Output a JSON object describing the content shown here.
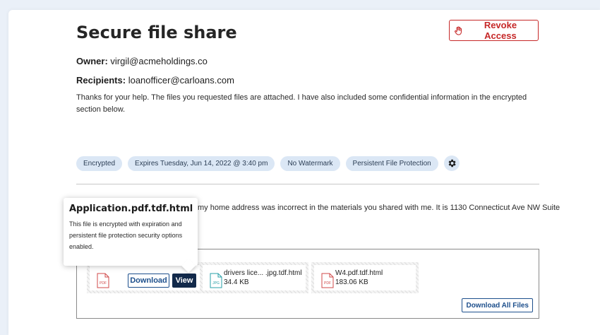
{
  "page": {
    "title": "Secure file share",
    "revoke_label": "Revoke Access",
    "owner_label": "Owner:",
    "owner_value": "virgil@acmeholdings.co",
    "recipients_label": "Recipients:",
    "recipients_value": "loanofficer@carloans.com",
    "message": "Thanks for your help. The files you requested files are attached. I have also included some confidential information in the encrypted section below."
  },
  "tags": [
    {
      "label": "Encrypted"
    },
    {
      "label": "Expires Tuesday, Jun 14, 2022 @ 3:40 pm"
    },
    {
      "label": "No Watermark"
    },
    {
      "label": "Persistent File Protection"
    }
  ],
  "encrypted_note": "my home address was incorrect in the materials you shared with me. It is 1130 Connecticut Ave NW Suite",
  "files": [
    {
      "icon": "pdf-file-icon",
      "icon_text": "PDF",
      "download_label": "Download",
      "view_label": "View"
    },
    {
      "icon": "jpg-file-icon",
      "icon_text": "JPG",
      "name": "drivers lice... .jpg.tdf.html",
      "size": "34.4 KB"
    },
    {
      "icon": "pdf-file-icon",
      "icon_text": "PDF",
      "name": "W4.pdf.tdf.html",
      "size": "183.06 KB"
    }
  ],
  "download_all_label": "Download All Files",
  "tooltip": {
    "title": "Application.pdf.tdf.html",
    "body": "This file is encrypted with expiration and persistent file protection security options enabled."
  },
  "colors": {
    "accent_red": "#c62828",
    "primary_blue": "#1d4f8c",
    "dark_navy": "#12294a",
    "tag_bg": "#dbe7f5"
  }
}
